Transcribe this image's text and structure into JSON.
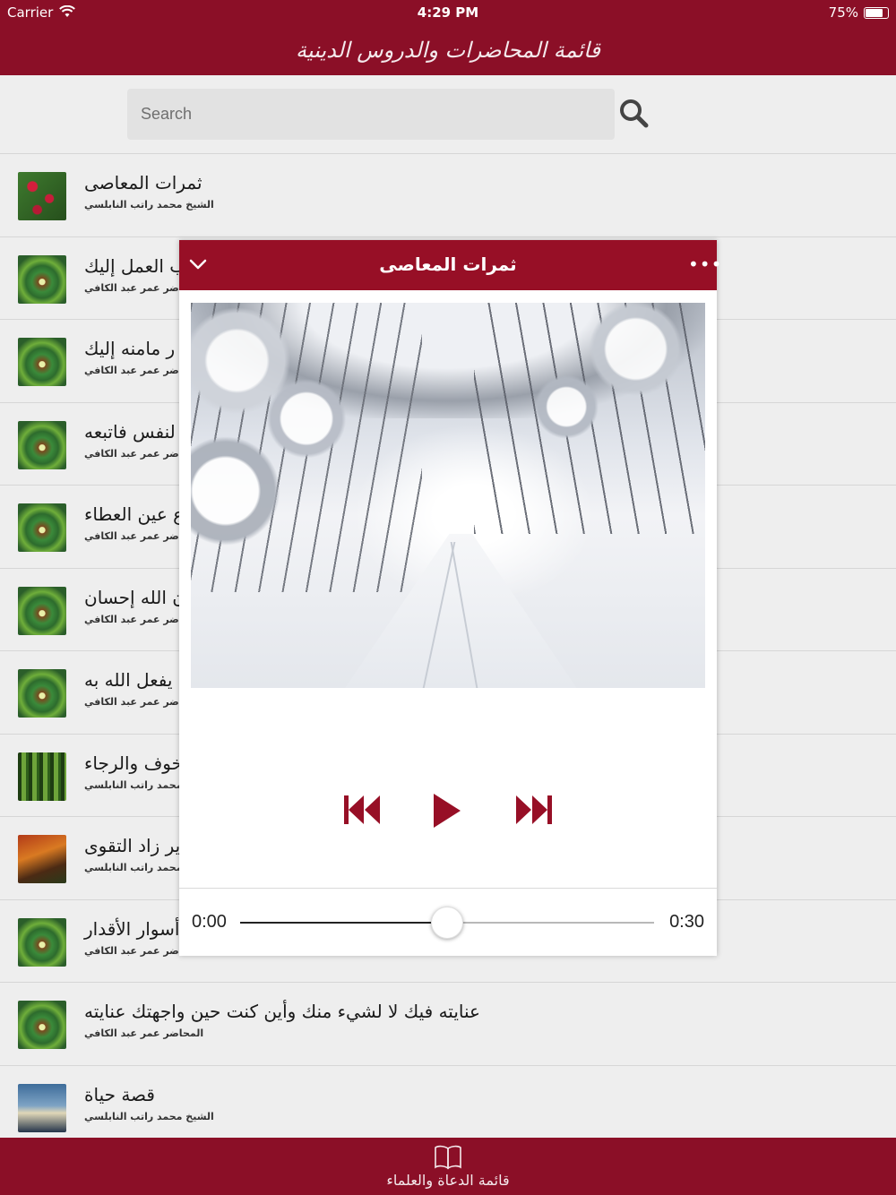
{
  "status_bar": {
    "carrier": "Carrier",
    "time": "4:29 PM",
    "battery": "75%"
  },
  "nav": {
    "title": "قائمة المحاضرات والدروس الدينية"
  },
  "search": {
    "placeholder": "Search"
  },
  "list": {
    "items": [
      {
        "title": "ثمرات المعاصى",
        "subtitle": "الشيخ محمد راتب النابلسي",
        "thumb": "rose"
      },
      {
        "title": "ب العمل إليك",
        "subtitle": "اضر عمر عبد الكافي",
        "thumb": "green"
      },
      {
        "title": "ر مامنه إليك",
        "subtitle": "اضر عمر عبد الكافي",
        "thumb": "green"
      },
      {
        "title": "لنفس فاتبعه",
        "subtitle": "اضر عمر عبد الكافي",
        "thumb": "green"
      },
      {
        "title": "ع عين العطاء",
        "subtitle": "اضر عمر عبد الكافي",
        "thumb": "green"
      },
      {
        "title": "ن الله إحسان",
        "subtitle": "اضر عمر عبد الكافي",
        "thumb": "green"
      },
      {
        "title": "ا يفعل الله به",
        "subtitle": "اضر عمر عبد الكافي",
        "thumb": "green"
      },
      {
        "title": "خوف والرجاء",
        "subtitle": "محمد راتب النابلسي",
        "thumb": "forest"
      },
      {
        "title": "ير زاد التقوى",
        "subtitle": "محمد راتب النابلسي",
        "thumb": "autumn"
      },
      {
        "title": "أسوار الأقدار",
        "subtitle": "اضر عمر عبد الكافي",
        "thumb": "green"
      },
      {
        "title": "عنايته فيك لا لشيء منك وأين كنت حين واجهتك عنايته",
        "subtitle": "المحاضر عمر عبد الكافي",
        "thumb": "green"
      },
      {
        "title": "قصة حياة",
        "subtitle": "الشيخ محمد راتب النابلسي",
        "thumb": "sky"
      }
    ]
  },
  "tab_bar": {
    "label": "قائمة الدعاة والعلماء",
    "icon": "book-icon"
  },
  "player": {
    "title": "ثمرات المعاصى",
    "more_label": "•••",
    "collapse_icon": "chevron-down-icon",
    "elapsed": "0:00",
    "total": "0:30",
    "progress": 0.5
  },
  "colors": {
    "brand": "#8b0f27",
    "player_accent": "#970f26",
    "background": "#eeeeee"
  }
}
